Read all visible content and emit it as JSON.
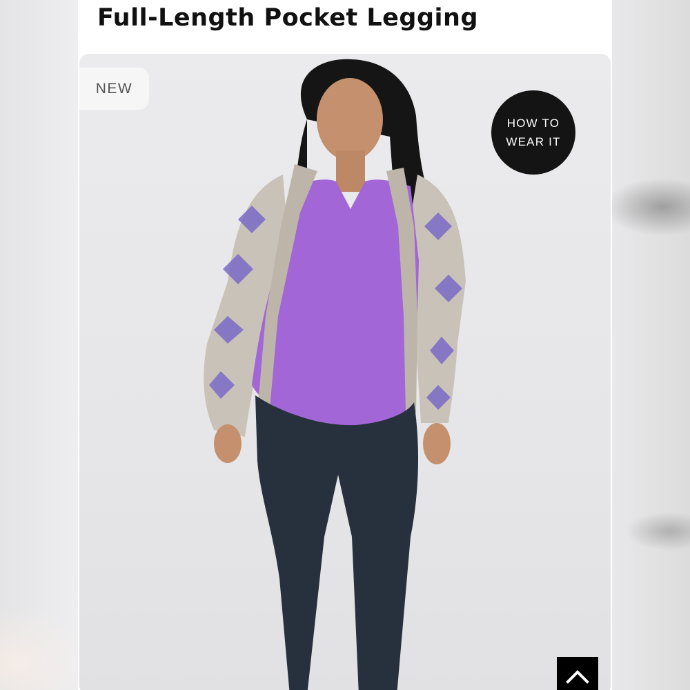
{
  "product": {
    "title": "Full-Length Pocket Legging",
    "badge": "NEW",
    "how_to_wear": {
      "line1": "HOW TO",
      "line2": "WEAR IT"
    },
    "image_alt": "Model wearing purple v-neck top, patterned cardigan and navy full-length leggings"
  },
  "controls": {
    "scroll_top_icon": "chevron-up-icon"
  },
  "colors": {
    "top": "#a366d6",
    "leggings": "#26313d",
    "cardigan": "#c9c2b8",
    "cardigan_pattern": "#7a6bc6",
    "badge_bg": "#f6f6f6",
    "button_bg": "#141414"
  }
}
